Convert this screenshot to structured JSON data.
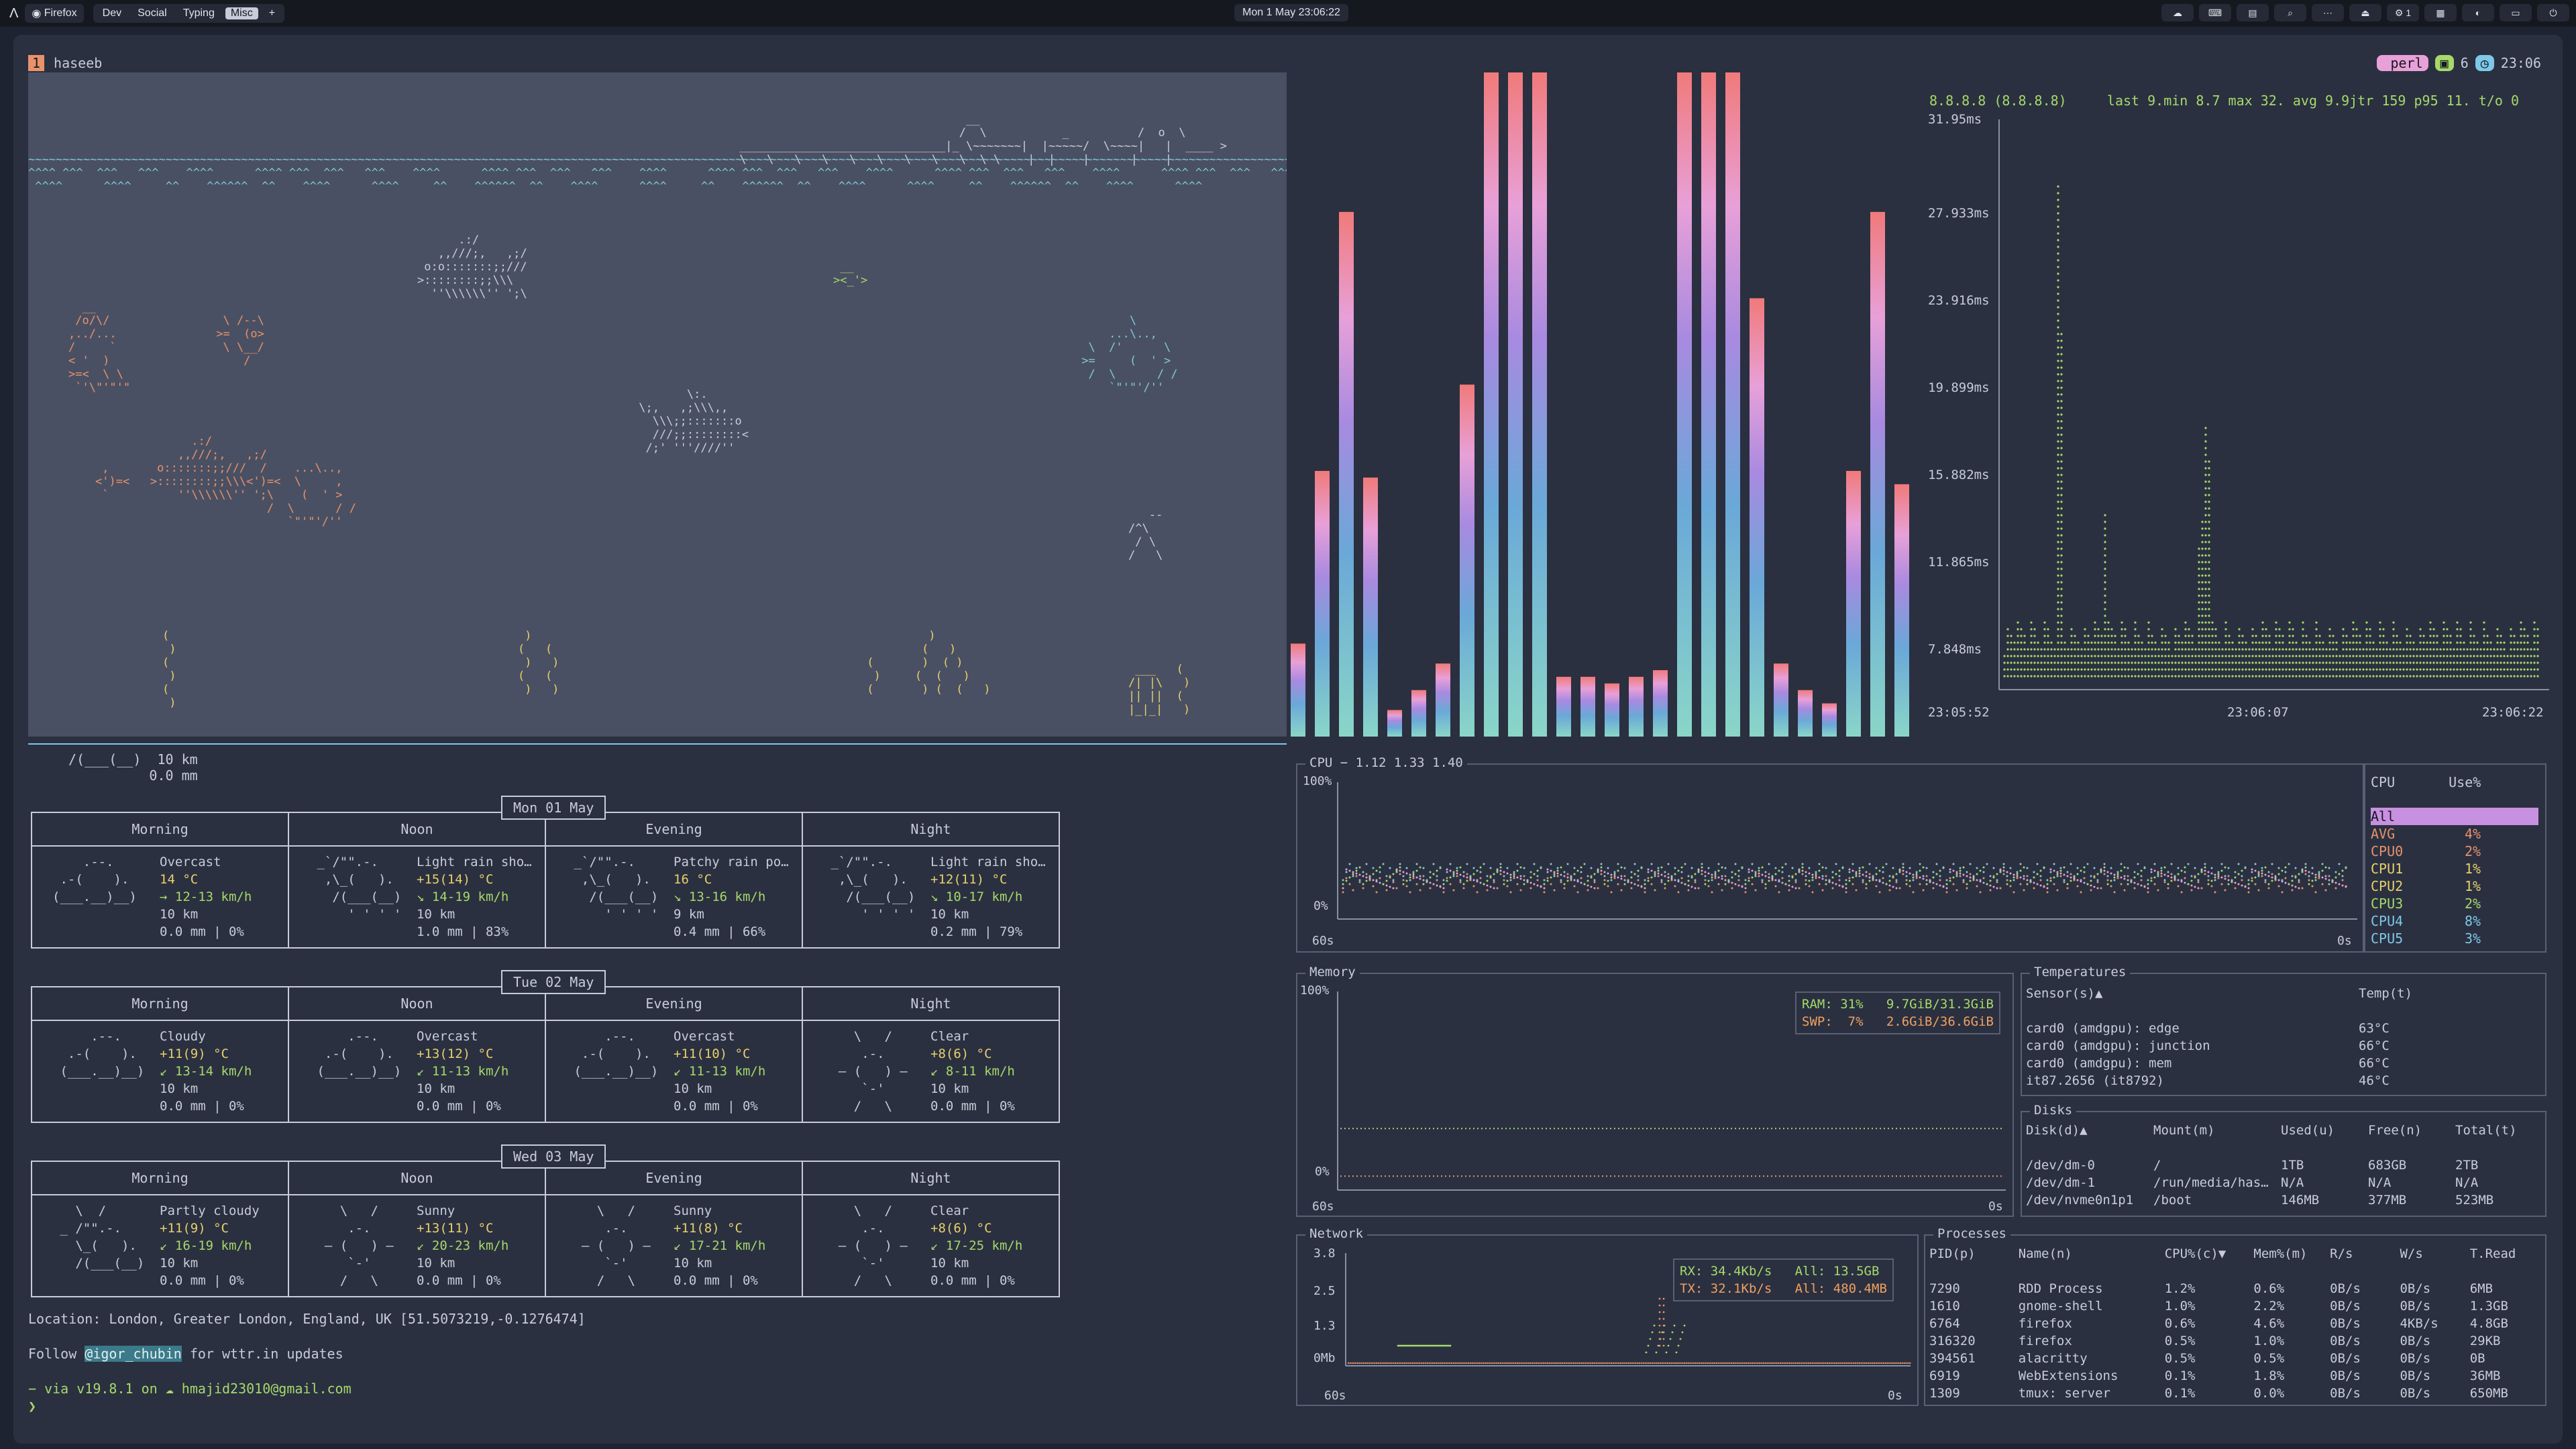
{
  "topbar": {
    "app": "Firefox",
    "workspaces": [
      "Dev",
      "Social",
      "Typing",
      "Misc"
    ],
    "active_workspace": "Misc",
    "plus": "+",
    "clock": "Mon 1 May 23:06:22",
    "tray": [
      "☁",
      "⌨",
      "▤",
      "⌕",
      "⋯",
      "⏏",
      "⚙ 1",
      "▦",
      "◐",
      "▭",
      "⏻"
    ]
  },
  "terminal": {
    "tab_number": "1",
    "tab_name": "haseeb",
    "status": {
      "mode": "perl",
      "windows": "6",
      "time": "23:06"
    }
  },
  "weather": {
    "header_lines": [
      "/(___(__)  10 km",
      "          0.0 mm"
    ],
    "periods": [
      "Morning",
      "Noon",
      "Evening",
      "Night"
    ],
    "days": [
      {
        "date": "Mon 01 May",
        "cells": [
          {
            "icon": "    .--.\n .-(    ).\n(___.__)__)",
            "cond": "Overcast",
            "temp": "14 °C",
            "wind": "→ 12-13 km/h",
            "vis": "10 km",
            "rain": "0.0 mm | 0%"
          },
          {
            "icon": " _`/\"\".-.\n  ,\\_(   ).\n   /(___(__)\n     ' ' ' '",
            "cond": "Light rain sho…",
            "temp": "+15(14) °C",
            "wind": "↘ 14-19 km/h",
            "vis": "10 km",
            "rain": "1.0 mm | 83%"
          },
          {
            "icon": " _`/\"\".-.\n  ,\\_(   ).\n   /(___(__)\n     ' ' ' '",
            "cond": "Patchy rain po…",
            "temp": "16 °C",
            "wind": "↘ 13-16 km/h",
            "vis": "9 km",
            "rain": "0.4 mm | 66%"
          },
          {
            "icon": " _`/\"\".-.\n  ,\\_(   ).\n   /(___(__)\n     ' ' ' '",
            "cond": "Light rain sho…",
            "temp": "+12(11) °C",
            "wind": "↘ 10-17 km/h",
            "vis": "10 km",
            "rain": "0.2 mm | 79%"
          }
        ]
      },
      {
        "date": "Tue 02 May",
        "cells": [
          {
            "icon": "     .--.\n  .-(    ).\n (___.__)__)",
            "cond": "Cloudy",
            "temp": "+11(9) °C",
            "wind": "↙ 13-14 km/h",
            "vis": "10 km",
            "rain": "0.0 mm | 0%"
          },
          {
            "icon": "     .--.\n  .-(    ).\n (___.__)__)",
            "cond": "Overcast",
            "temp": "+13(12) °C",
            "wind": "↙ 11-13 km/h",
            "vis": "10 km",
            "rain": "0.0 mm | 0%"
          },
          {
            "icon": "     .--.\n  .-(    ).\n (___.__)__)",
            "cond": "Overcast",
            "temp": "+11(10) °C",
            "wind": "↙ 11-13 km/h",
            "vis": "10 km",
            "rain": "0.0 mm | 0%"
          },
          {
            "icon": "    \\   /\n     .-.\n  ― (   ) ―\n     `-'\n    /   \\",
            "cond": "Clear",
            "temp": "+8(6) °C",
            "wind": "↙ 8-11 km/h",
            "vis": "10 km",
            "rain": "0.0 mm | 0%"
          }
        ]
      },
      {
        "date": "Wed 03 May",
        "cells": [
          {
            "icon": "   \\  /\n _ /\"\".-.\n   \\_(   ).\n   /(___(__)",
            "cond": "Partly cloudy",
            "temp": "+11(9) °C",
            "wind": "↙ 16-19 km/h",
            "vis": "10 km",
            "rain": "0.0 mm | 0%"
          },
          {
            "icon": "    \\   /\n     .-.\n  ― (   ) ―\n     `-'\n    /   \\",
            "cond": "Sunny",
            "temp": "+13(11) °C",
            "wind": "↙ 20-23 km/h",
            "vis": "10 km",
            "rain": "0.0 mm | 0%"
          },
          {
            "icon": "    \\   /\n     .-.\n  ― (   ) ―\n     `-'\n    /   \\",
            "cond": "Sunny",
            "temp": "+11(8) °C",
            "wind": "↙ 17-21 km/h",
            "vis": "10 km",
            "rain": "0.0 mm | 0%"
          },
          {
            "icon": "    \\   /\n     .-.\n  ― (   ) ―\n     `-'\n    /   \\",
            "cond": "Clear",
            "temp": "+8(6) °C",
            "wind": "↙ 17-25 km/h",
            "vis": "10 km",
            "rain": "0.0 mm | 0%"
          }
        ]
      }
    ],
    "location": "Location: London, Greater London, England, UK [51.5073219,-0.1276474]",
    "follow_prefix": "Follow ",
    "follow_handle": "@igor_chubin",
    "follow_suffix": " for wttr.in updates",
    "prompt_line": "− via  v19.8.1 on ☁  hmajid23010@gmail.com",
    "prompt_symbol": "❯"
  },
  "ping": {
    "header": "8.8.8.8 (8.8.8.8)",
    "stats": "last 9.min 8.7 max 32. avg 9.9jtr 159 p95 11. t/o 0",
    "y_ticks": [
      "31.95ms",
      "27.933ms",
      "23.916ms",
      "19.899ms",
      "15.882ms",
      "11.865ms",
      "7.848ms"
    ],
    "x_ticks": [
      "23:05:52",
      "23:06:07",
      "23:06:22"
    ]
  },
  "cpu": {
    "title": "CPU − 1.12 1.33 1.40",
    "y_top": "100%",
    "y_bottom": "0%",
    "x_left": "60s",
    "x_right": "0s",
    "list_header": [
      "CPU",
      "Use%"
    ],
    "rows": [
      {
        "name": "All",
        "use": ""
      },
      {
        "name": "AVG",
        "use": "4%"
      },
      {
        "name": "CPU0",
        "use": "2%"
      },
      {
        "name": "CPU1",
        "use": "1%"
      },
      {
        "name": "CPU2",
        "use": "1%"
      },
      {
        "name": "CPU3",
        "use": "2%"
      },
      {
        "name": "CPU4",
        "use": "8%"
      },
      {
        "name": "CPU5",
        "use": "3%"
      }
    ]
  },
  "memory": {
    "title": "Memory",
    "y_top": "100%",
    "y_bottom": "0%",
    "x_left": "60s",
    "x_right": "0s",
    "ram": "RAM: 31%   9.7GiB/31.3GiB",
    "swp": "SWP:  7%   2.6GiB/36.6GiB"
  },
  "temperatures": {
    "title": "Temperatures",
    "headers": [
      "Sensor(s)▲",
      "Temp(t)"
    ],
    "rows": [
      [
        "card0 (amdgpu): edge",
        "63°C"
      ],
      [
        "card0 (amdgpu): junction",
        "66°C"
      ],
      [
        "card0 (amdgpu): mem",
        "66°C"
      ],
      [
        "it87.2656 (it8792)",
        "46°C"
      ]
    ]
  },
  "disks": {
    "title": "Disks",
    "headers": [
      "Disk(d)▲",
      "Mount(m)",
      "Used(u)",
      "Free(n)",
      "Total(t)"
    ],
    "rows": [
      [
        "/dev/dm-0",
        "/",
        "1TB",
        "683GB",
        "2TB"
      ],
      [
        "/dev/dm-1",
        "/run/media/has…",
        "N/A",
        "N/A",
        "N/A"
      ],
      [
        "/dev/nvme0n1p1",
        "/boot",
        "146MB",
        "377MB",
        "523MB"
      ]
    ]
  },
  "network": {
    "title": "Network",
    "y_ticks": [
      "3.8",
      "2.5",
      "1.3",
      "0Mb"
    ],
    "x_left": "60s",
    "x_right": "0s",
    "rx": "RX: 34.4Kb/s",
    "rx_all": "All: 13.5GB",
    "tx": "TX: 32.1Kb/s",
    "tx_all": "All: 480.4MB"
  },
  "processes": {
    "title": "Processes",
    "headers": [
      "PID(p)",
      "Name(n)",
      "CPU%(c)▼",
      "Mem%(m)",
      "R/s",
      "W/s",
      "T.Read"
    ],
    "rows": [
      [
        "7290",
        "RDD Process",
        "1.2%",
        "0.6%",
        "0B/s",
        "0B/s",
        "6MB"
      ],
      [
        "1610",
        "gnome-shell",
        "1.0%",
        "2.2%",
        "0B/s",
        "0B/s",
        "1.3GB"
      ],
      [
        "6764",
        "firefox",
        "0.6%",
        "4.6%",
        "0B/s",
        "4KB/s",
        "4.8GB"
      ],
      [
        "316320",
        "firefox",
        "0.5%",
        "1.0%",
        "0B/s",
        "0B/s",
        "29KB"
      ],
      [
        "394561",
        "alacritty",
        "0.5%",
        "0.5%",
        "0B/s",
        "0B/s",
        "0B"
      ],
      [
        "6919",
        "WebExtensions",
        "0.1%",
        "1.8%",
        "0B/s",
        "0B/s",
        "36MB"
      ],
      [
        "1309",
        "tmux: server",
        "0.1%",
        "0.0%",
        "0B/s",
        "0B/s",
        "650MB"
      ]
    ]
  },
  "bars": [
    0.14,
    0.4,
    0.79,
    0.39,
    0.04,
    0.07,
    0.11,
    0.53,
    1.0,
    1.0,
    1.0,
    0.09,
    0.09,
    0.08,
    0.09,
    0.1,
    1.0,
    1.0,
    1.0,
    0.66,
    0.11,
    0.07,
    0.05,
    0.4,
    0.79,
    0.38,
    0.16
  ]
}
